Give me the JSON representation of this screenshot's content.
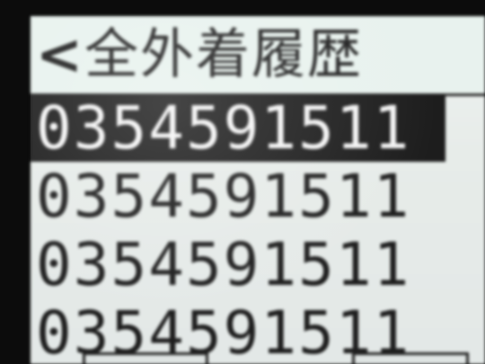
{
  "header": {
    "back_icon": "<",
    "title": "全外着履歴"
  },
  "history": {
    "items": [
      {
        "number": "0354591511",
        "selected": true
      },
      {
        "number": "0354591511",
        "selected": false
      },
      {
        "number": "0354591511",
        "selected": false
      },
      {
        "number": "0354591511",
        "selected": false
      }
    ]
  },
  "icons": {
    "back": "chevron-left-icon"
  },
  "colors": {
    "screen_bg": "#e7ece9",
    "header_bg": "#e8f2ee",
    "text": "#1e1e1e",
    "selected_bg": "#1d1d1d",
    "selected_text": "#f4f4f4"
  }
}
